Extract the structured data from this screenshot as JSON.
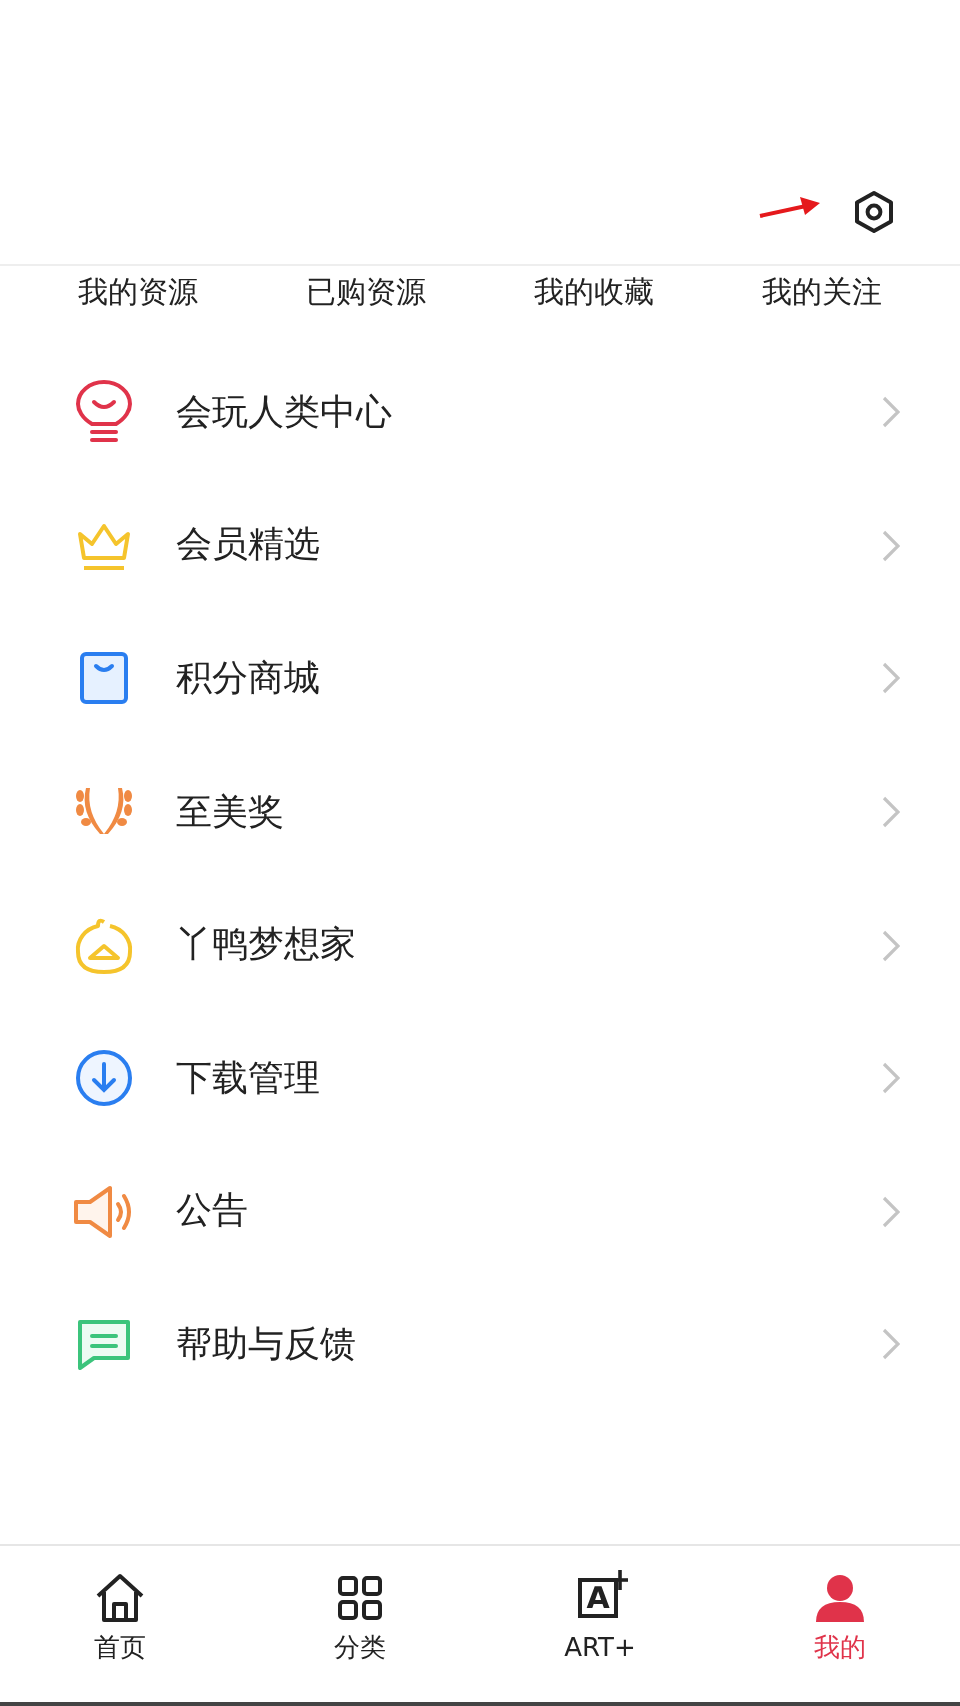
{
  "tabs": [
    {
      "label": "我的资源"
    },
    {
      "label": "已购资源"
    },
    {
      "label": "我的收藏"
    },
    {
      "label": "我的关注"
    }
  ],
  "menu": [
    {
      "label": "会玩人类中心",
      "kind": "bulb"
    },
    {
      "label": "会员精选",
      "kind": "crown"
    },
    {
      "label": "积分商城",
      "kind": "bag"
    },
    {
      "label": "至美奖",
      "kind": "laurel"
    },
    {
      "label": "丫鸭梦想家",
      "kind": "duck"
    },
    {
      "label": "下载管理",
      "kind": "download"
    },
    {
      "label": "公告",
      "kind": "speaker"
    },
    {
      "label": "帮助与反馈",
      "kind": "message"
    }
  ],
  "bottom_nav": [
    {
      "label": "首页",
      "kind": "home",
      "selected": false
    },
    {
      "label": "分类",
      "kind": "grid",
      "selected": false
    },
    {
      "label": "ART+",
      "kind": "art",
      "icon_letter": "A",
      "selected": false
    },
    {
      "label": "我的",
      "kind": "person",
      "selected": true
    }
  ]
}
